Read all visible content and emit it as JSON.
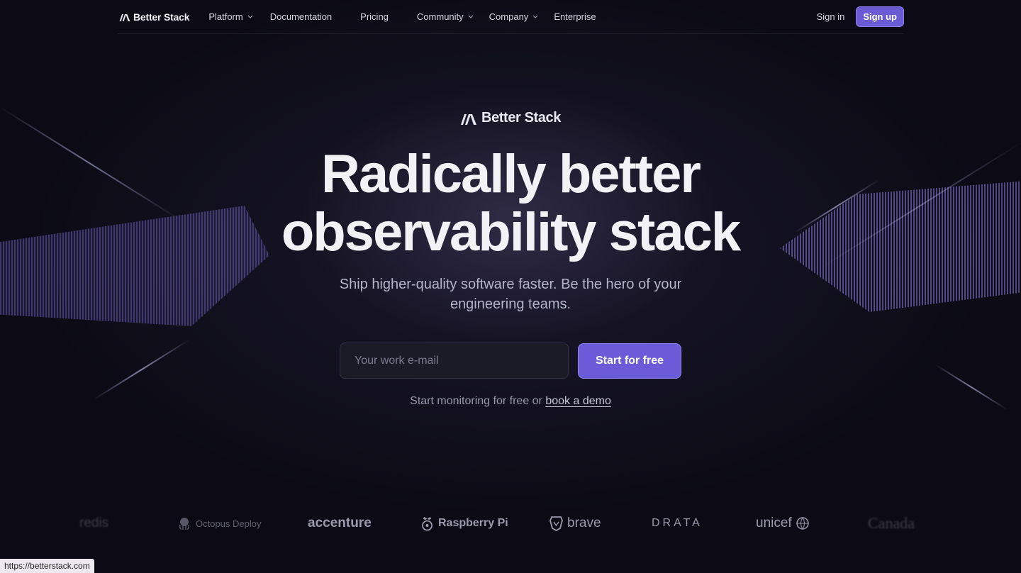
{
  "nav": {
    "brand": "Better Stack",
    "items": [
      {
        "label": "Platform",
        "has_dropdown": true
      },
      {
        "label": "Documentation",
        "has_dropdown": false
      },
      {
        "label": "Pricing",
        "has_dropdown": false
      },
      {
        "label": "Community",
        "has_dropdown": true
      },
      {
        "label": "Company",
        "has_dropdown": true
      },
      {
        "label": "Enterprise",
        "has_dropdown": false
      }
    ],
    "signin": "Sign in",
    "signup": "Sign up"
  },
  "hero": {
    "brand": "Better Stack",
    "headline_line1": "Radically better",
    "headline_line2": "observability stack",
    "subtext": "Ship higher-quality software faster. Be the hero of your engineering teams.",
    "email_placeholder": "Your work e-mail",
    "cta": "Start for free",
    "demo_prefix": "Start monitoring for free or ",
    "demo_link": "book a demo"
  },
  "logos": [
    "redis",
    "Octopus Deploy",
    "accenture",
    "Raspberry Pi",
    "brave",
    "DRATA",
    "unicef",
    "Canada"
  ],
  "status_bar_url": "https://betterstack.com",
  "colors": {
    "background": "#0c0b15",
    "accent": "#6b5bd8"
  }
}
